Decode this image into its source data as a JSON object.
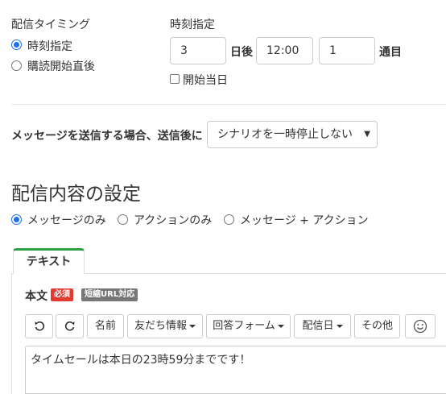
{
  "timing": {
    "label": "配信タイミング",
    "options": [
      {
        "label": "時刻指定",
        "checked": true
      },
      {
        "label": "購読開始直後",
        "checked": false
      }
    ]
  },
  "time_spec": {
    "label": "時刻指定",
    "days_value": "3",
    "days_unit": "日後",
    "time_value": "12:00",
    "nth_value": "1",
    "nth_unit": "通目",
    "start_day_label": "開始当日",
    "start_day_checked": false
  },
  "after_send": {
    "label": "メッセージを送信する場合、送信後に",
    "selected": "シナリオを一時停止しない"
  },
  "content": {
    "title": "配信内容の設定",
    "options": [
      {
        "label": "メッセージのみ",
        "checked": true
      },
      {
        "label": "アクションのみ",
        "checked": false
      },
      {
        "label": "メッセージ + アクション",
        "checked": false
      }
    ]
  },
  "tabs": [
    {
      "label": "テキスト",
      "active": true
    }
  ],
  "body": {
    "label": "本文",
    "badge_required": "必須",
    "badge_short_url": "短縮URL対応",
    "colors": {
      "required": "#e03c31",
      "short_url": "#777777"
    }
  },
  "toolbar": {
    "undo_icon": "undo-icon",
    "redo_icon": "redo-icon",
    "name": "名前",
    "friend_info": "友だち情報",
    "answer_form": "回答フォーム",
    "delivery_date": "配信日",
    "other": "その他",
    "emoji_icon": "smile-icon"
  },
  "editor": {
    "text": "タイムセールは本日の23時59分までです！"
  }
}
